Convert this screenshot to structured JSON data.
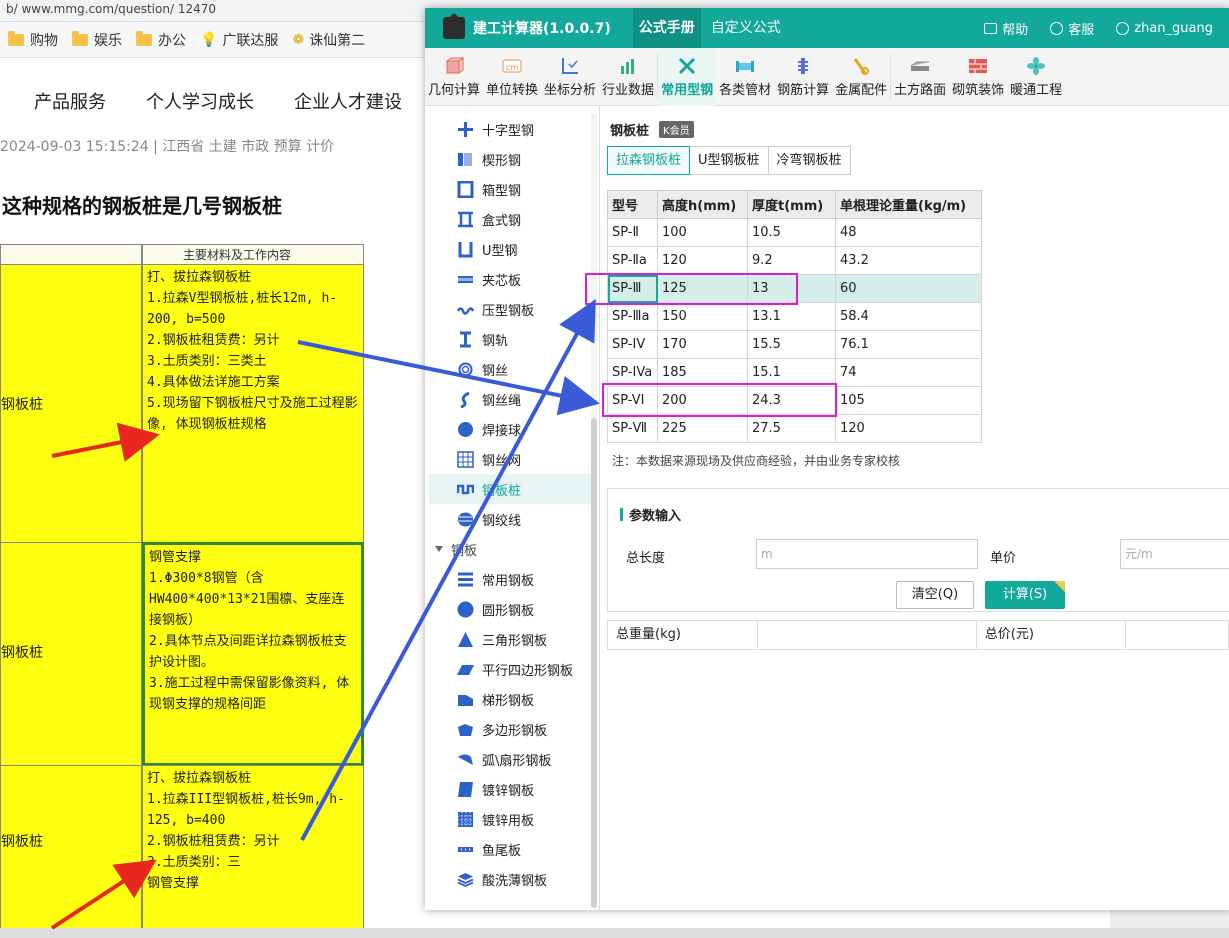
{
  "browser": {
    "address_text": "b/ www.mmg.com/question/ 12470",
    "bookmarks": [
      "购物",
      "娱乐",
      "办公",
      "广联达服",
      "诛仙第二"
    ],
    "nav": [
      "产品服务",
      "个人学习成长",
      "企业人才建设"
    ],
    "meta": "2024-09-03 15:15:24   |   江西省  土建 市政 预算 计价",
    "question_title": "这种规格的钢板桩是几号钢板桩",
    "sheet": {
      "header_text": "主要材料及工作内容",
      "rows": [
        {
          "left": "钢板桩",
          "right": "打、拔拉森钢板桩\n1.拉森V型钢板桩,桩长12m, h-200, b=500\n2.钢板桩租赁费：另计\n3.土质类别：三类土\n4.具体做法详施工方案\n5.现场留下钢板桩尺寸及施工过程影像, 体现钢板桩规格"
        },
        {
          "left": "钢板桩",
          "right": "钢管支撑\n1.Φ300*8钢管（含HW400*400*13*21围檩、支座连接钢板）\n2.具体节点及间距详拉森钢板桩支护设计图。\n3.施工过程中需保留影像资料, 体现钢支撑的规格间距"
        },
        {
          "left": "钢板桩",
          "right": "打、拔拉森钢板桩\n1.拉森III型钢板桩,桩长9m, h-125, b=400\n2.钢板桩租赁费：另计\n3.土质类别：三\n钢管支撑"
        }
      ]
    }
  },
  "app": {
    "title": "建工计算器(1.0.0.7)",
    "tabs": [
      "公式手册",
      "自定义公式"
    ],
    "active_tab": "公式手册",
    "right_items": [
      "帮助",
      "客服",
      "zhan_guang"
    ],
    "toolbar": [
      "几何计算",
      "单位转换",
      "坐标分析",
      "行业数据",
      "常用型钢",
      "各类管材",
      "钢筋计算",
      "金属配件",
      "土方路面",
      "砌筑装饰",
      "暖通工程"
    ],
    "active_tool": "常用型钢",
    "sidebar": [
      {
        "label": "十字型钢",
        "icon": "cross-steel-icon"
      },
      {
        "label": "楔形钢",
        "icon": "wedge-steel-icon"
      },
      {
        "label": "箱型钢",
        "icon": "box-steel-icon"
      },
      {
        "label": "盒式钢",
        "icon": "box-section-icon"
      },
      {
        "label": "U型钢",
        "icon": "u-steel-icon"
      },
      {
        "label": "夹芯板",
        "icon": "sandwich-panel-icon"
      },
      {
        "label": "压型钢板",
        "icon": "profiled-sheet-icon"
      },
      {
        "label": "钢轨",
        "icon": "rail-icon"
      },
      {
        "label": "钢丝",
        "icon": "steel-wire-icon"
      },
      {
        "label": "钢丝绳",
        "icon": "wire-rope-icon"
      },
      {
        "label": "焊接球",
        "icon": "weld-ball-icon"
      },
      {
        "label": "钢丝网",
        "icon": "wire-mesh-icon"
      },
      {
        "label": "钢板桩",
        "icon": "sheet-pile-icon",
        "active": true
      },
      {
        "label": "钢绞线",
        "icon": "strand-icon"
      }
    ],
    "sidebar_group": "钢板",
    "sidebar_group_items": [
      {
        "label": "常用钢板",
        "icon": "plate-icon"
      },
      {
        "label": "圆形钢板",
        "icon": "circle-plate-icon"
      },
      {
        "label": "三角形钢板",
        "icon": "triangle-plate-icon"
      },
      {
        "label": "平行四边形钢板",
        "icon": "parallelogram-plate-icon"
      },
      {
        "label": "梯形钢板",
        "icon": "trapezoid-plate-icon"
      },
      {
        "label": "多边形钢板",
        "icon": "polygon-plate-icon"
      },
      {
        "label": "弧\\扇形钢板",
        "icon": "sector-plate-icon"
      },
      {
        "label": "镀锌钢板",
        "icon": "galvanized-plate-icon"
      },
      {
        "label": "镀锌用板",
        "icon": "galvanized-sheet-icon"
      },
      {
        "label": "鱼尾板",
        "icon": "fishplate-icon"
      },
      {
        "label": "酸洗薄钢板",
        "icon": "pickled-plate-icon"
      }
    ],
    "content": {
      "title": "钢板桩",
      "vip_badge": "K会员",
      "subtabs": [
        "拉森钢板桩",
        "U型钢板桩",
        "冷弯钢板桩"
      ],
      "active_subtab": "拉森钢板桩",
      "table": {
        "headers": [
          "型号",
          "高度h(mm)",
          "厚度t(mm)",
          "单根理论重量(kg/m)"
        ],
        "rows": [
          [
            "SP-Ⅱ",
            "100",
            "10.5",
            "48"
          ],
          [
            "SP-Ⅱa",
            "120",
            "9.2",
            "43.2"
          ],
          [
            "SP-Ⅲ",
            "125",
            "13",
            "60"
          ],
          [
            "SP-Ⅲa",
            "150",
            "13.1",
            "58.4"
          ],
          [
            "SP-IV",
            "170",
            "15.5",
            "76.1"
          ],
          [
            "SP-IVa",
            "185",
            "15.1",
            "74"
          ],
          [
            "SP-VI",
            "200",
            "24.3",
            "105"
          ],
          [
            "SP-Ⅶ",
            "225",
            "27.5",
            "120"
          ]
        ],
        "selected_row": 2
      },
      "note": "注：本数据来源现场及供应商经验，并由业务专家校核",
      "params": {
        "title": "参数输入",
        "length_label": "总长度",
        "length_placeholder": "m",
        "price_label": "单价",
        "price_placeholder": "元/m",
        "clear_label": "清空(Q)",
        "calc_label": "计算(S)"
      },
      "result": {
        "weight_label": "总重量(kg)",
        "price_label": "总价(元)"
      }
    }
  },
  "colors": {
    "accent": "#12a89a",
    "highlight": "#d61fd6",
    "arrow_blue": "#3a5bd8",
    "arrow_red": "#e8281f",
    "cell_yellow": "#ffff11"
  }
}
